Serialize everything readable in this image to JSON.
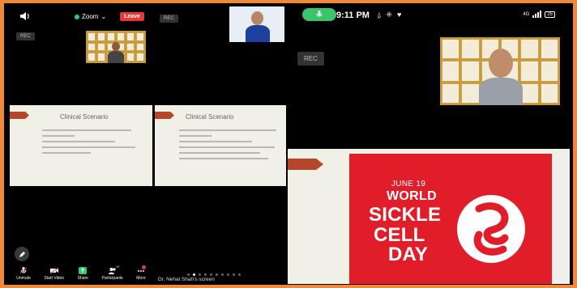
{
  "meeting": {
    "zoom_label": "Zoom",
    "leave_label": "Leave",
    "rec_label": "REC",
    "slide_title": "Clinical Scenario",
    "sharer_label": "Dr. Nehal Shah's screen"
  },
  "toolbar": {
    "items": [
      {
        "label": "Unmute",
        "icon": "mic-icon"
      },
      {
        "label": "Start Video",
        "icon": "video-icon"
      },
      {
        "label": "Share",
        "icon": "share-icon"
      },
      {
        "label": "Participants",
        "icon": "participants-icon",
        "badge": "47"
      },
      {
        "label": "More",
        "icon": "more-icon"
      }
    ]
  },
  "status_bar": {
    "time": "9:11 PM",
    "network": "4G",
    "battery": "25"
  },
  "banner": {
    "date": "JUNE 19",
    "line1": "WORLD",
    "line2": "SICKLE",
    "line3": "CELL",
    "line4": "DAY"
  },
  "colors": {
    "accent_orange": "#f08a3a",
    "leave_red": "#e53935",
    "share_green": "#2ecc71",
    "banner_red": "#e11d2a"
  }
}
